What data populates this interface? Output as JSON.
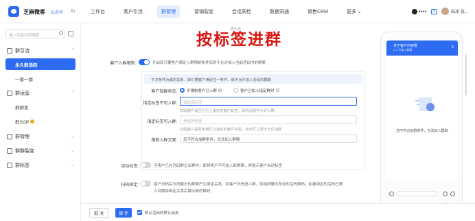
{
  "header": {
    "brand": "芝麻微客",
    "account_type": "公众号",
    "nav": [
      "工作台",
      "客户引流",
      "群管理",
      "营销裂变",
      "会话质检",
      "数据洞通",
      "销售CRM",
      "更多 ⌄"
    ],
    "active_nav": 2,
    "company_badge": "V",
    "user": "陆冰·张..."
  },
  "sidebar": {
    "search_placeholder": "输入功能名称搜索",
    "groups": [
      {
        "label": "群引流",
        "chev": "^"
      },
      {
        "label": "群运营",
        "chev": "^"
      },
      {
        "label": "群管理",
        "chev": "⌄"
      },
      {
        "label": "群群裂变",
        "chev": "⌄"
      },
      {
        "label": "群标签",
        "chev": "⌄"
      }
    ],
    "items": [
      "永久群活码",
      "一客一群",
      "群群发",
      "群SOP"
    ]
  },
  "main": {
    "breadcrumb": "群引流",
    "overlay_title": "按标签进群",
    "join_check": {
      "label": "客户入群限制:",
      "desc": "开启后只要客户满足入群限制条件后则不允许加入当前活码内的群聊",
      "enabled": true
    },
    "conditions_hint": "下方条件为或的关系，即只要客户满足任一条件，就不允许加入活码内群聊",
    "add_status": {
      "label": "客户加群状态:",
      "options": [
        "不限制客户已入群",
        "客户已加入指定群时"
      ],
      "selected": 0
    },
    "not_allowed_tags": {
      "label": "指定标签不可入群:",
      "placeholder": "请选择标签",
      "hint": "扫码客户是否已打上指定的客户标签，是的话则不允许入群"
    },
    "allowed_tags": {
      "label": "指定标签可入群:",
      "placeholder": "请选择标签",
      "hint": "扫码客户是否未被打上指定的客户标签，如未打上则不允许加群"
    },
    "limit_text": {
      "label": "限制入群文案:",
      "value": "您不符合加群条件，无法加入群聊"
    },
    "auto_mark": {
      "label": "自动标签:",
      "desc": "当客户已在活码群企业群内，即将客户不可加入新群聊，将提示客户自动标签",
      "enabled": false
    },
    "scan_notify": {
      "label": "扫码绑定:",
      "desc_line1": "客户扫码后与所展示的群聊产生绑定关系，如客户扫码进入群，则始终展示所有的活码群码，如被绑定的活码已满",
      "desc_line2": "入到解除绑定关系后展示新的群码",
      "enabled": false
    }
  },
  "phone": {
    "title": "关于客户内容群",
    "subtitle": "0 人已加入群聊",
    "menu": "≡",
    "message": "您不符合加群条件，无法加入群聊",
    "nav": [
      "◁",
      "○",
      "□"
    ]
  },
  "footer": {
    "cancel": "取 消",
    "save": "保 存",
    "checkbox_label": "默认活码的默认启用"
  },
  "colors": {
    "accent": "#2d6bf2",
    "overlay_red": "#d9150f"
  }
}
